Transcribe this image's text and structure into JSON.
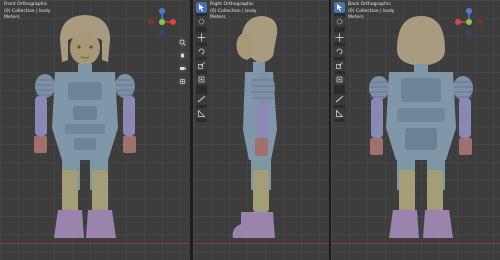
{
  "viewports": [
    {
      "view_label": "Front Orthographic",
      "collection_label": "(0) Collection | body",
      "units_label": "Meters"
    },
    {
      "view_label": "Right Orthographic",
      "collection_label": "(0) Collection | body",
      "units_label": "Meters"
    },
    {
      "view_label": "Back Orthographic",
      "collection_label": "(0) Collection | body",
      "units_label": "Meters"
    }
  ],
  "gizmo": {
    "x_color": "#d6454b",
    "y_color": "#8bc34a",
    "z_color": "#4b7bd6"
  },
  "colors": {
    "armor": "#7f97a8",
    "skin_face": "#a89876",
    "boots": "#9a83ad",
    "shin_guard": "#a39e78",
    "gloves": "#a0706c",
    "hair": "#a99b7f"
  }
}
